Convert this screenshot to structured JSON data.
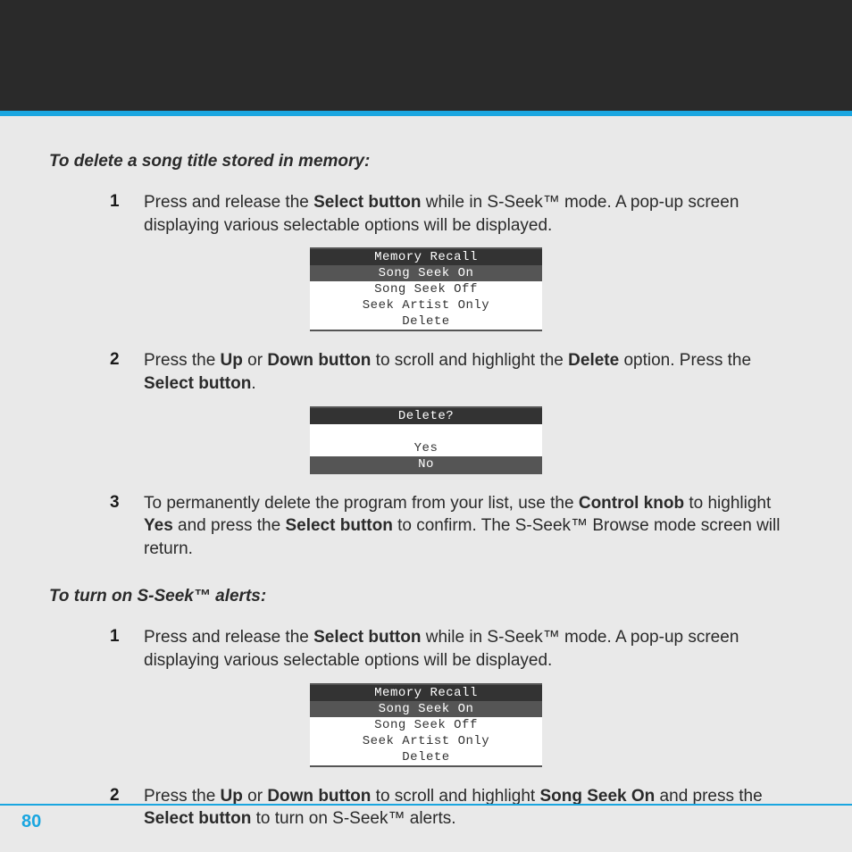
{
  "page_number": "80",
  "section1": {
    "heading": "To delete a song title stored in memory:",
    "steps": [
      {
        "num": "1",
        "pre": "Press and release the ",
        "b1": "Select button",
        "post": " while in S-Seek™ mode.  A pop-up screen displaying various selectable options will be displayed."
      },
      {
        "num": "2",
        "pre": "Press the ",
        "b1": "Up",
        "mid1": " or ",
        "b2": "Down button",
        "mid2": " to scroll and highlight the ",
        "b3": "Delete",
        "mid3": " option. Press the ",
        "b4": "Select button",
        "post": "."
      },
      {
        "num": "3",
        "pre": "To permanently delete the program from your list, use the ",
        "b1": "Control knob",
        "mid1": " to highlight ",
        "b2": "Yes",
        "mid2": " and press the ",
        "b3": "Select button",
        "post": " to confirm. The S-Seek™ Browse mode screen will return."
      }
    ]
  },
  "section2": {
    "heading": "To turn on S-Seek™ alerts:",
    "steps": [
      {
        "num": "1",
        "pre": "Press and release the ",
        "b1": "Select button",
        "post": " while in S-Seek™ mode.  A pop-up screen displaying various selectable options will be displayed."
      },
      {
        "num": "2",
        "pre": "Press the ",
        "b1": "Up",
        "mid1": " or ",
        "b2": "Down button",
        "mid2": " to scroll and highlight ",
        "b3": "Song Seek On",
        "mid3": " and press the ",
        "b4": "Select button",
        "post": " to turn on S-Seek™ alerts."
      }
    ]
  },
  "menus": {
    "memory": {
      "title": "Memory Recall",
      "items": [
        "Song Seek On",
        "Song Seek Off",
        "Seek Artist Only",
        "Delete"
      ]
    },
    "delete": {
      "title": "Delete?",
      "blank": " ",
      "yes": "Yes",
      "no": "No"
    }
  }
}
